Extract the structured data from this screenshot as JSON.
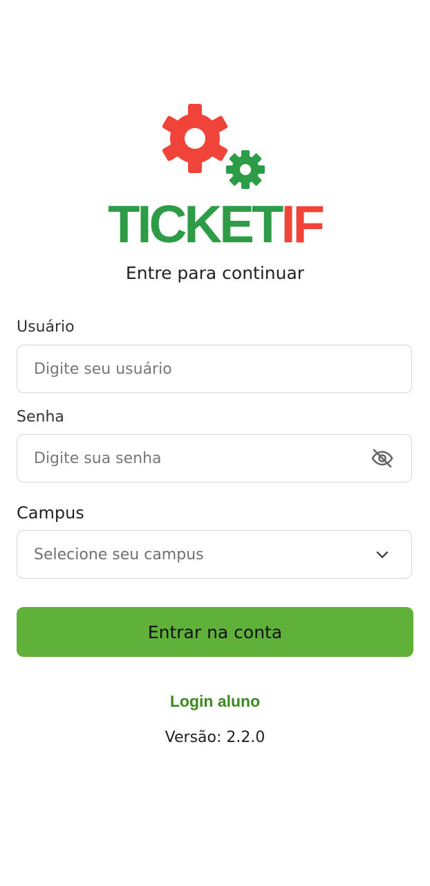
{
  "logo": {
    "text_main": "TICKET",
    "text_accent": "IF",
    "colors": {
      "main": "#2e9b47",
      "accent": "#f0443a"
    },
    "icon": "gears-icon"
  },
  "subtitle": "Entre para continuar",
  "form": {
    "username": {
      "label": "Usuário",
      "placeholder": "Digite seu usuário",
      "value": ""
    },
    "password": {
      "label": "Senha",
      "placeholder": "Digite sua senha",
      "value": "",
      "toggle_icon": "eye-off-icon"
    },
    "campus": {
      "label": "Campus",
      "selected": "Selecione seu campus",
      "icon": "chevron-down-icon"
    },
    "submit_label": "Entrar na conta"
  },
  "student_login_label": "Login aluno",
  "version_text": "Versão: 2.2.0",
  "colors": {
    "primary_button": "#5fb13a",
    "link": "#3b8a1f"
  }
}
